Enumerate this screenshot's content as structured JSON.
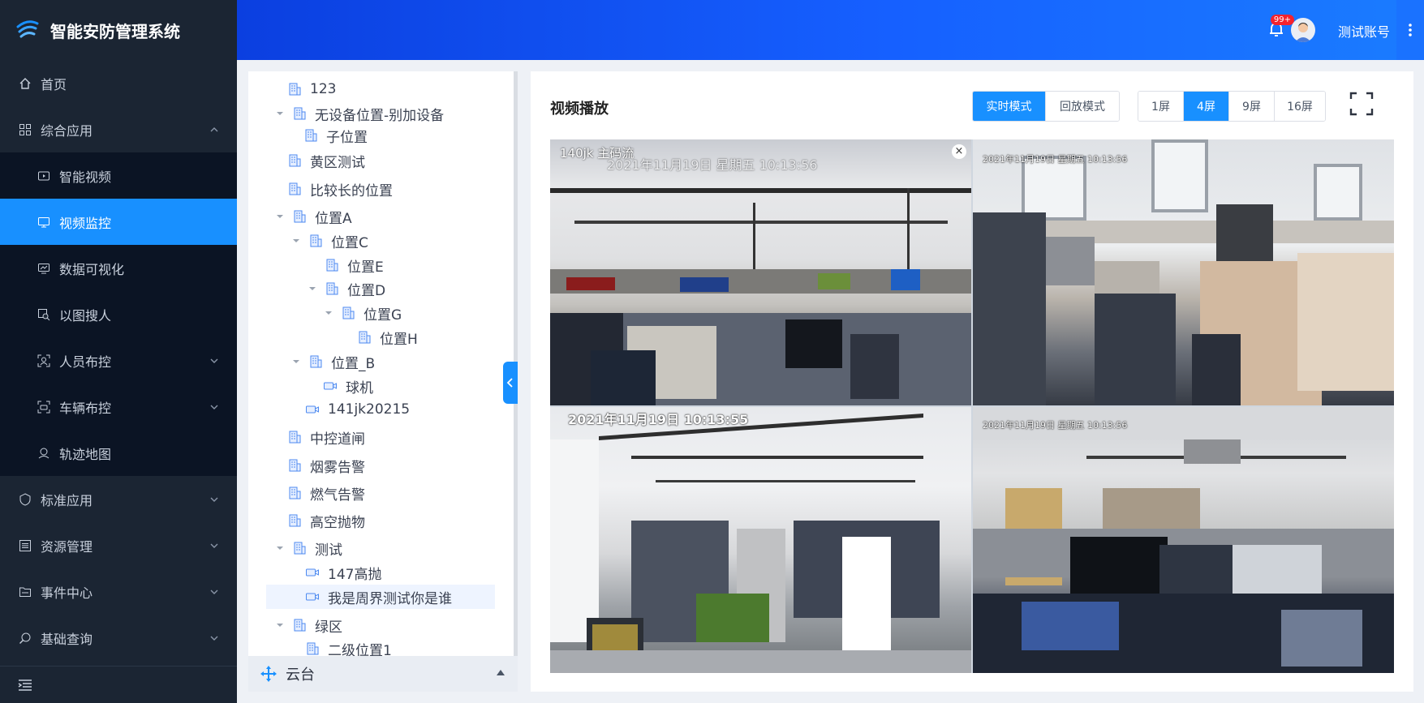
{
  "app": {
    "title": "智能安防管理系统"
  },
  "header": {
    "badge": "99+",
    "username": "测试账号"
  },
  "sidebar": {
    "items": [
      {
        "label": "首页",
        "icon": "home-icon"
      },
      {
        "label": "综合应用",
        "icon": "grid-icon",
        "expanded": true,
        "children": [
          {
            "label": "智能视频",
            "icon": "video-icon"
          },
          {
            "label": "视频监控",
            "icon": "monitor-icon",
            "active": true
          },
          {
            "label": "数据可视化",
            "icon": "chart-icon"
          },
          {
            "label": "以图搜人",
            "icon": "image-search-icon"
          },
          {
            "label": "人员布控",
            "icon": "person-scan-icon"
          },
          {
            "label": "车辆布控",
            "icon": "vehicle-scan-icon"
          },
          {
            "label": "轨迹地图",
            "icon": "map-icon"
          }
        ]
      },
      {
        "label": "标准应用",
        "icon": "shield-icon"
      },
      {
        "label": "资源管理",
        "icon": "list-icon"
      },
      {
        "label": "事件中心",
        "icon": "folder-icon"
      },
      {
        "label": "基础查询",
        "icon": "search-icon"
      }
    ]
  },
  "tree": {
    "nodes": [
      {
        "label": "123",
        "type": "building"
      },
      {
        "label": "无设备位置-别加设备",
        "type": "building"
      },
      {
        "label": "子位置",
        "type": "building"
      },
      {
        "label": "黄区测试",
        "type": "building"
      },
      {
        "label": "比较长的位置",
        "type": "building"
      },
      {
        "label": "位置A",
        "type": "building"
      },
      {
        "label": "位置C",
        "type": "building"
      },
      {
        "label": "位置E",
        "type": "building"
      },
      {
        "label": "位置D",
        "type": "building"
      },
      {
        "label": "位置G",
        "type": "building"
      },
      {
        "label": "位置H",
        "type": "building"
      },
      {
        "label": "位置_B",
        "type": "building"
      },
      {
        "label": "球机",
        "type": "camera"
      },
      {
        "label": "141jk20215",
        "type": "camera"
      },
      {
        "label": "中控道闸",
        "type": "building"
      },
      {
        "label": "烟雾告警",
        "type": "building"
      },
      {
        "label": "燃气告警",
        "type": "building"
      },
      {
        "label": "高空抛物",
        "type": "building"
      },
      {
        "label": "测试",
        "type": "building"
      },
      {
        "label": "147高抛",
        "type": "camera"
      },
      {
        "label": "我是周界测试你是谁",
        "type": "camera",
        "selected": true
      },
      {
        "label": "绿区",
        "type": "building"
      },
      {
        "label": "二级位置1",
        "type": "building"
      }
    ],
    "ptz_label": "云台"
  },
  "video": {
    "title": "视频播放",
    "modes": [
      "实时模式",
      "回放模式"
    ],
    "active_mode": "实时模式",
    "layouts": [
      "1屏",
      "4屏",
      "9屏",
      "16屏"
    ],
    "active_layout": "4屏",
    "cells": [
      {
        "name": "140jk 主码流",
        "osd": "2021年11月19日  星期五  10:13:56"
      },
      {
        "osd": "2021年11月19日 星期五 10:13:56"
      },
      {
        "osd": "2021年11月19日  10:13:55"
      },
      {
        "osd": "2021年11月19日 星期五 10:13:56"
      }
    ]
  },
  "colors": {
    "accent": "#1890ff",
    "sidebar_bg": "#1b2533",
    "submenu_bg": "#0b1424",
    "header_start": "#0b3fe0",
    "header_end": "#1a7cff"
  }
}
